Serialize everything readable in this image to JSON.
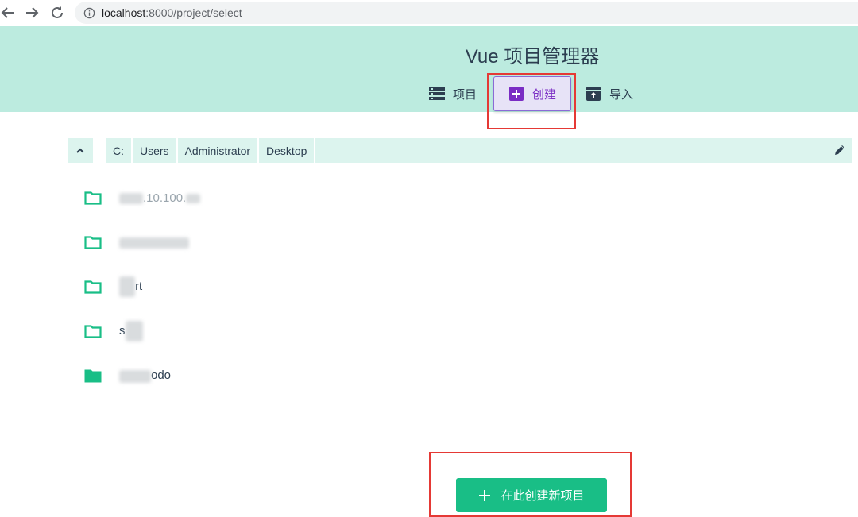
{
  "browser": {
    "url_host": "localhost",
    "url_path": ":8000/project/select"
  },
  "header": {
    "title": "Vue 项目管理器",
    "tabs": [
      {
        "label": "项目",
        "icon": "list-icon"
      },
      {
        "label": "创建",
        "icon": "plus-box-icon",
        "active": true
      },
      {
        "label": "导入",
        "icon": "unarchive-icon"
      }
    ]
  },
  "path": {
    "segments": [
      "C:",
      "Users",
      "Administrator",
      "Desktop"
    ]
  },
  "folders": [
    {
      "name": ".10.100.",
      "icon": "folder-outline-icon"
    },
    {
      "name": "",
      "icon": "folder-outline-icon"
    },
    {
      "name": "rt",
      "icon": "folder-outline-icon"
    },
    {
      "name": "s",
      "icon": "folder-outline-icon"
    },
    {
      "name": "odo",
      "icon": "folder-filled-icon"
    }
  ],
  "actions": {
    "create_here": "在此创建新项目"
  },
  "colors": {
    "accent": "#42b983",
    "header_bg": "#bcebdf",
    "create_tab": "#7a2cc4",
    "highlight": "#e53935"
  }
}
